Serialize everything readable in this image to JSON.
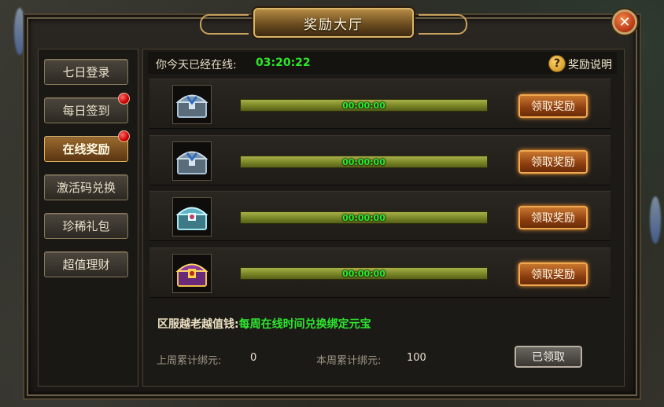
{
  "title": "奖励大厅",
  "close_icon": "close-x",
  "menu": {
    "items": [
      {
        "label": "七日登录",
        "active": false,
        "badge": false
      },
      {
        "label": "每日签到",
        "active": false,
        "badge": true
      },
      {
        "label": "在线奖励",
        "active": true,
        "badge": true
      },
      {
        "label": "激活码兑换",
        "active": false,
        "badge": false
      },
      {
        "label": "珍稀礼包",
        "active": false,
        "badge": false
      },
      {
        "label": "超值理财",
        "active": false,
        "badge": false
      }
    ]
  },
  "online": {
    "label": "你今天已经在线:",
    "time": "03:20:22",
    "help_label": "奖励说明",
    "help_icon": "question-mark"
  },
  "rewards": [
    {
      "chest": "silver-chest-icon",
      "timer": "00:00:00",
      "claim_label": "领取奖励"
    },
    {
      "chest": "silver-chest-icon",
      "timer": "00:00:00",
      "claim_label": "领取奖励"
    },
    {
      "chest": "cyan-chest-icon",
      "timer": "00:00:00",
      "claim_label": "领取奖励"
    },
    {
      "chest": "gold-chest-icon",
      "timer": "00:00:00",
      "claim_label": "领取奖励"
    }
  ],
  "notice": {
    "prefix": "区服越老越值钱:",
    "text": "每周在线时间兑换绑定元宝"
  },
  "stats": {
    "last_week_label": "上周累计绑元:",
    "last_week_value": "0",
    "this_week_label": "本周累计绑元:",
    "this_week_value": "100"
  },
  "claimed_label": "已领取",
  "colors": {
    "accent_green": "#2ee82e",
    "gold_border": "#f0a850",
    "badge_red": "#cc0000"
  }
}
